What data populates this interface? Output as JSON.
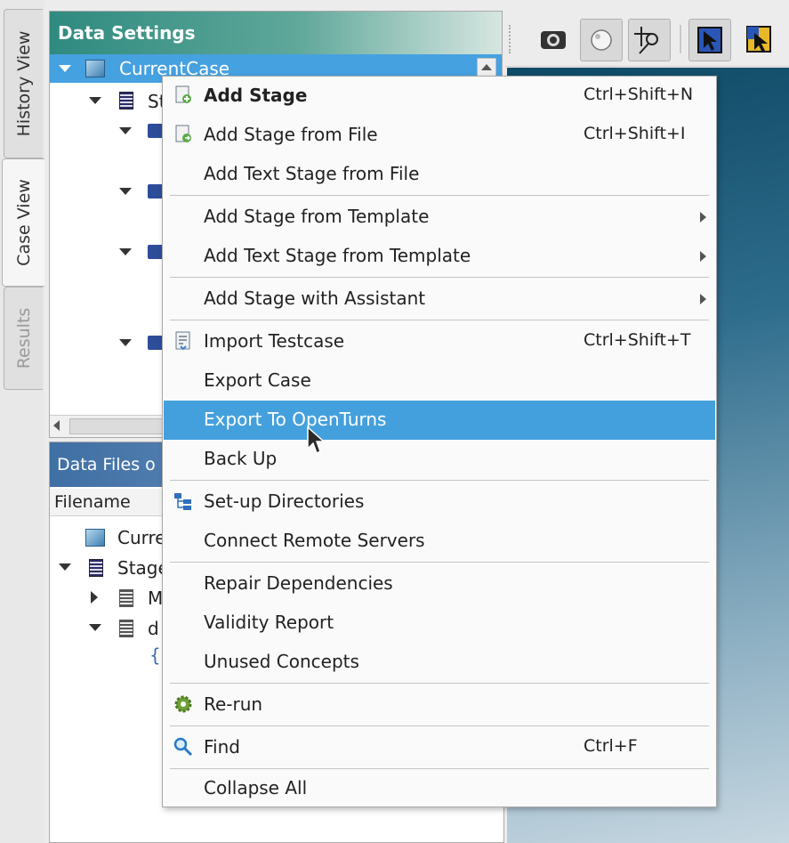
{
  "side_tabs": [
    {
      "label": "History View",
      "state": "normal"
    },
    {
      "label": "Case View",
      "state": "active"
    },
    {
      "label": "Results",
      "state": "disabled"
    }
  ],
  "data_settings": {
    "title": "Data Settings",
    "selected_item": "CurrentCase",
    "row2_text": "St"
  },
  "data_files": {
    "title": "Data Files o",
    "column_header": "Filename",
    "rows": [
      "Curre",
      "Stage",
      "M",
      "d",
      "{"
    ]
  },
  "toolbar_icons": [
    "camera-icon",
    "sphere-view-icon",
    "probe-icon",
    "select-cursor-icon",
    "select-region-icon"
  ],
  "context_menu": {
    "items": [
      {
        "label": "Add Stage",
        "shortcut": "Ctrl+Shift+N",
        "bold": true,
        "icon": "add-stage-icon"
      },
      {
        "label": "Add Stage from File",
        "shortcut": "Ctrl+Shift+I",
        "icon": "add-stage-file-icon"
      },
      {
        "label": "Add Text Stage from File",
        "shortcut": ""
      },
      {
        "label": "Add Stage from Template",
        "shortcut": "",
        "submenu": true
      },
      {
        "label": "Add Text Stage from Template",
        "shortcut": "",
        "submenu": true
      },
      {
        "label": "Add Stage with Assistant",
        "shortcut": "",
        "submenu": true
      },
      {
        "label": "Import Testcase",
        "shortcut": "Ctrl+Shift+T",
        "icon": "import-testcase-icon"
      },
      {
        "label": "Export Case",
        "shortcut": ""
      },
      {
        "label": "Export To OpenTurns",
        "shortcut": "",
        "highlighted": true
      },
      {
        "label": "Back Up",
        "shortcut": ""
      },
      {
        "label": "Set-up Directories",
        "shortcut": "",
        "icon": "directories-icon"
      },
      {
        "label": "Connect Remote Servers",
        "shortcut": ""
      },
      {
        "label": "Repair Dependencies",
        "shortcut": ""
      },
      {
        "label": "Validity Report",
        "shortcut": ""
      },
      {
        "label": "Unused Concepts",
        "shortcut": ""
      },
      {
        "label": "Re-run",
        "shortcut": "",
        "icon": "gear-icon"
      },
      {
        "label": "Find",
        "shortcut": "Ctrl+F",
        "icon": "search-icon"
      },
      {
        "label": "Collapse All",
        "shortcut": ""
      }
    ]
  },
  "colors": {
    "highlight": "#44a0dc",
    "tree_selection": "#45a1e0",
    "header_teal": "#2f8a7f"
  }
}
